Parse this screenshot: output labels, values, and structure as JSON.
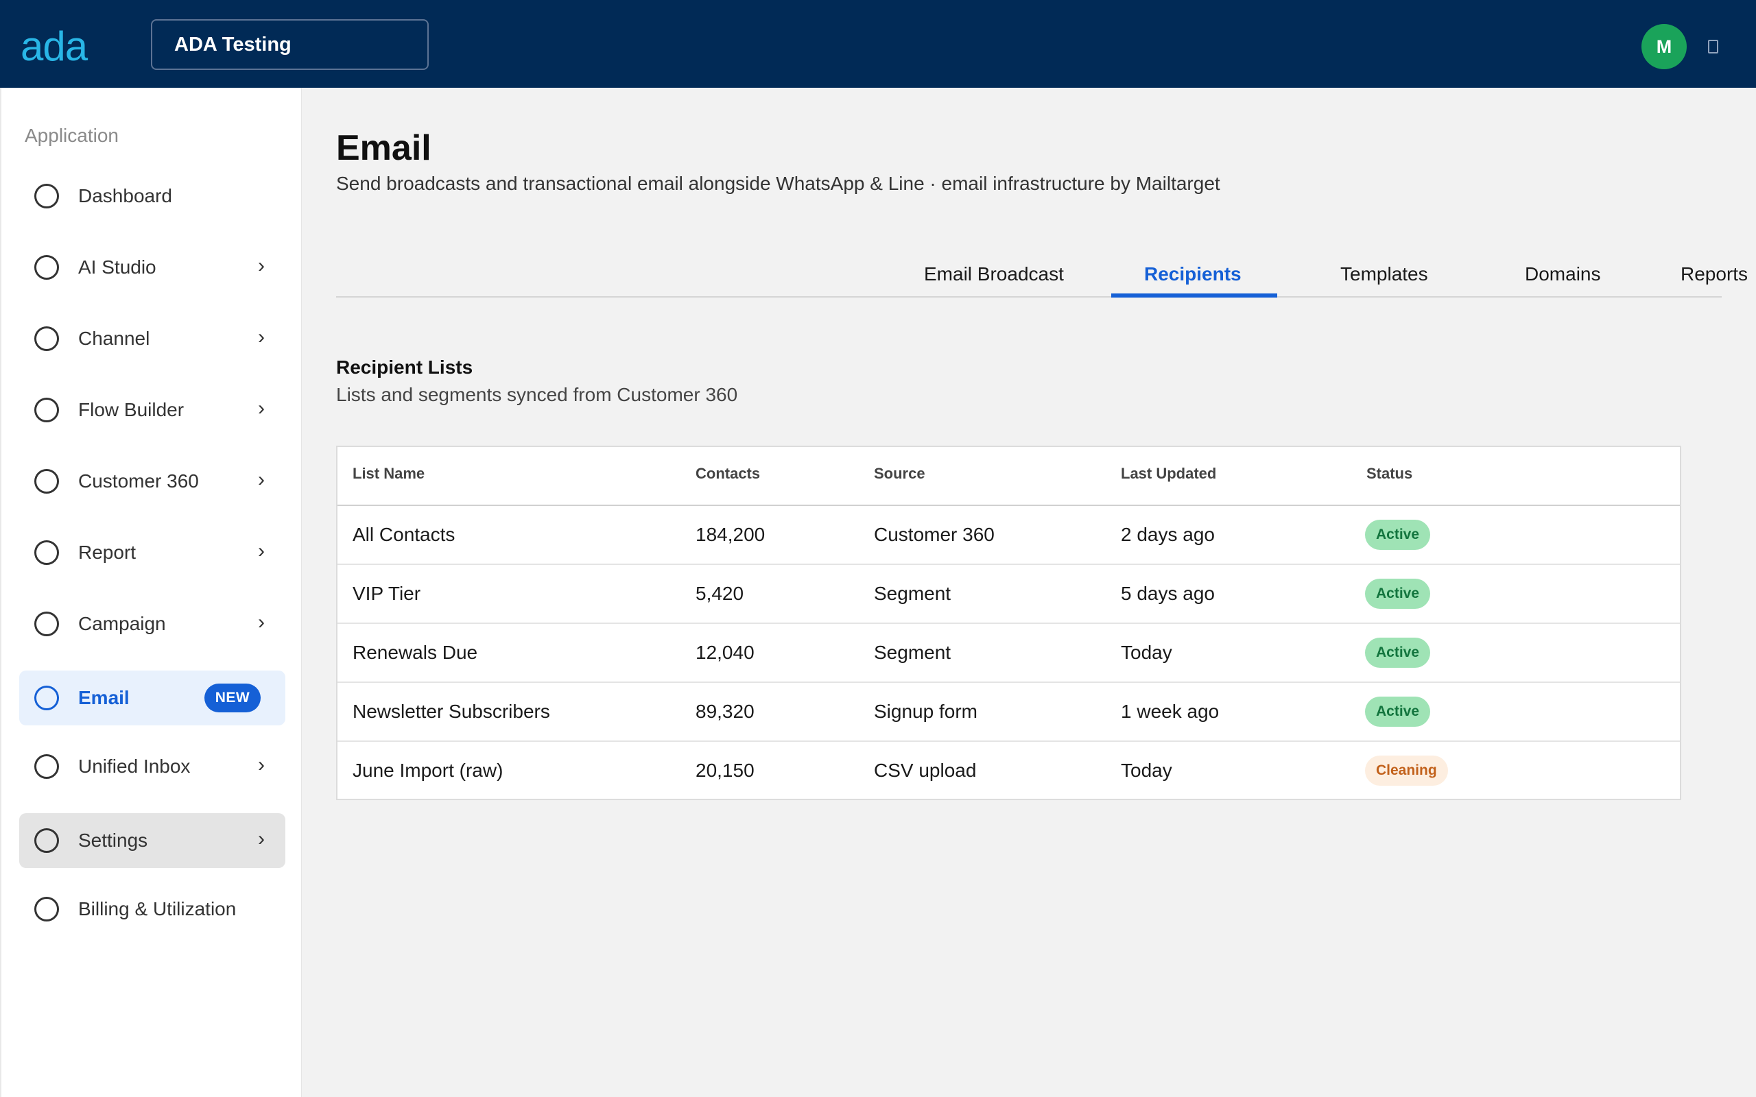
{
  "header": {
    "logo": "ada",
    "workspace": "ADA Testing",
    "avatar_initial": "M"
  },
  "sidebar": {
    "heading": "Application",
    "items": [
      {
        "label": "Dashboard",
        "chevron": ""
      },
      {
        "label": "AI Studio",
        "chevron": "›"
      },
      {
        "label": "Channel",
        "chevron": "›"
      },
      {
        "label": "Flow Builder",
        "chevron": "›"
      },
      {
        "label": "Customer 360",
        "chevron": "›"
      },
      {
        "label": "Report",
        "chevron": "›"
      },
      {
        "label": "Campaign",
        "chevron": "›"
      },
      {
        "label": "Email",
        "badge": "NEW",
        "state": "active"
      },
      {
        "label": "Unified Inbox",
        "chevron": "›"
      },
      {
        "label": "Settings",
        "chevron": "›",
        "state": "hover"
      },
      {
        "label": "Billing & Utilization",
        "chevron": ""
      }
    ]
  },
  "page": {
    "title": "Email",
    "subtitle": "Send broadcasts and transactional email alongside WhatsApp & Line · email infrastructure by Mailtarget"
  },
  "tabs": [
    {
      "label": "Email Broadcast"
    },
    {
      "label": "Recipients",
      "active": true
    },
    {
      "label": "Templates"
    },
    {
      "label": "Domains"
    },
    {
      "label": "Reports"
    }
  ],
  "section": {
    "title": "Recipient Lists",
    "subtitle": "Lists and segments synced from Customer 360"
  },
  "table": {
    "columns": [
      "List Name",
      "Contacts",
      "Source",
      "Last Updated",
      "Status"
    ],
    "rows": [
      {
        "name": "All Contacts",
        "contacts": "184,200",
        "source": "Customer 360",
        "updated": "2 days ago",
        "status": "Active"
      },
      {
        "name": "VIP Tier",
        "contacts": "5,420",
        "source": "Segment",
        "updated": "5 days ago",
        "status": "Active"
      },
      {
        "name": "Renewals Due",
        "contacts": "12,040",
        "source": "Segment",
        "updated": "Today",
        "status": "Active"
      },
      {
        "name": "Newsletter Subscribers",
        "contacts": "89,320",
        "source": "Signup form",
        "updated": "1 week ago",
        "status": "Active"
      },
      {
        "name": "June Import (raw)",
        "contacts": "20,150",
        "source": "CSV upload",
        "updated": "Today",
        "status": "Cleaning"
      }
    ]
  },
  "colors": {
    "topbar": "#012a56",
    "accent": "#1560d6",
    "logo": "#29b6e6",
    "avatar": "#1aa35a",
    "status_active_bg": "#9fe3b5",
    "status_cleaning_bg": "#fdeee0"
  }
}
